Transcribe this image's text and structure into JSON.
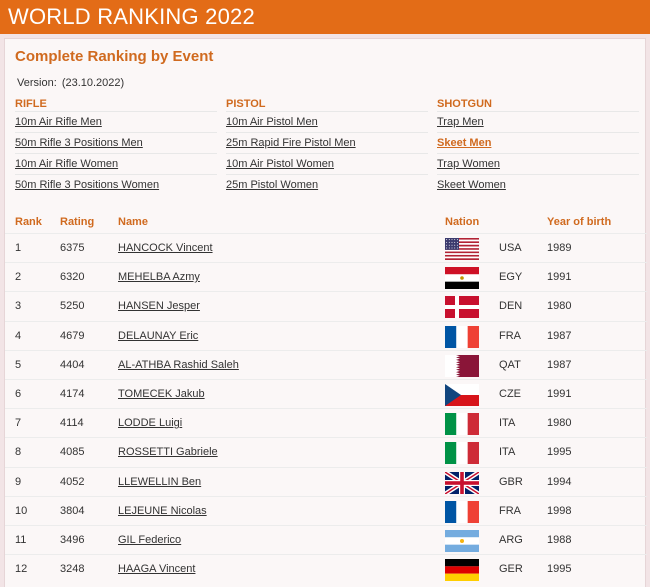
{
  "header": {
    "title": "WORLD RANKING 2022"
  },
  "section": {
    "title": "Complete Ranking by Event",
    "version_label": "Version:",
    "version_value": "(23.10.2022)"
  },
  "categories": [
    {
      "name": "RIFLE",
      "links": [
        "10m Air Rifle Men",
        "50m Rifle 3 Positions Men",
        "10m Air Rifle Women",
        "50m Rifle 3 Positions Women"
      ]
    },
    {
      "name": "PISTOL",
      "links": [
        "10m Air Pistol Men",
        "25m Rapid Fire Pistol Men",
        "10m Air Pistol Women",
        "25m Pistol Women"
      ]
    },
    {
      "name": "SHOTGUN",
      "links": [
        "Trap Men",
        "Skeet Men",
        "Trap Women",
        "Skeet Women"
      ],
      "active": "Skeet Men"
    }
  ],
  "table": {
    "headers": {
      "rank": "Rank",
      "rating": "Rating",
      "name": "Name",
      "nation": "Nation",
      "year": "Year of birth"
    },
    "rows": [
      {
        "rank": "1",
        "rating": "6375",
        "name": "HANCOCK Vincent",
        "flag": "usa-flag-icon",
        "nation": "USA",
        "year": "1989"
      },
      {
        "rank": "2",
        "rating": "6320",
        "name": "MEHELBA Azmy",
        "flag": "egypt-flag-icon",
        "nation": "EGY",
        "year": "1991"
      },
      {
        "rank": "3",
        "rating": "5250",
        "name": "HANSEN Jesper",
        "flag": "denmark-flag-icon",
        "nation": "DEN",
        "year": "1980"
      },
      {
        "rank": "4",
        "rating": "4679",
        "name": "DELAUNAY Eric",
        "flag": "france-flag-icon",
        "nation": "FRA",
        "year": "1987"
      },
      {
        "rank": "5",
        "rating": "4404",
        "name": "AL-ATHBA Rashid Saleh",
        "flag": "qatar-flag-icon",
        "nation": "QAT",
        "year": "1987"
      },
      {
        "rank": "6",
        "rating": "4174",
        "name": "TOMECEK Jakub",
        "flag": "czechia-flag-icon",
        "nation": "CZE",
        "year": "1991"
      },
      {
        "rank": "7",
        "rating": "4114",
        "name": "LODDE Luigi",
        "flag": "italy-flag-icon",
        "nation": "ITA",
        "year": "1980"
      },
      {
        "rank": "8",
        "rating": "4085",
        "name": "ROSSETTI Gabriele",
        "flag": "italy-flag-icon",
        "nation": "ITA",
        "year": "1995"
      },
      {
        "rank": "9",
        "rating": "4052",
        "name": "LLEWELLIN Ben",
        "flag": "uk-flag-icon",
        "nation": "GBR",
        "year": "1994"
      },
      {
        "rank": "10",
        "rating": "3804",
        "name": "LEJEUNE Nicolas",
        "flag": "france-flag-icon",
        "nation": "FRA",
        "year": "1998"
      },
      {
        "rank": "11",
        "rating": "3496",
        "name": "GIL Federico",
        "flag": "argentina-flag-icon",
        "nation": "ARG",
        "year": "1988"
      },
      {
        "rank": "12",
        "rating": "3248",
        "name": "HAAGA Vincent",
        "flag": "germany-flag-icon",
        "nation": "GER",
        "year": "1995"
      }
    ]
  },
  "colors": {
    "accent": "#e36c17",
    "heading": "#d06a1f",
    "background": "#f2e4e6"
  }
}
